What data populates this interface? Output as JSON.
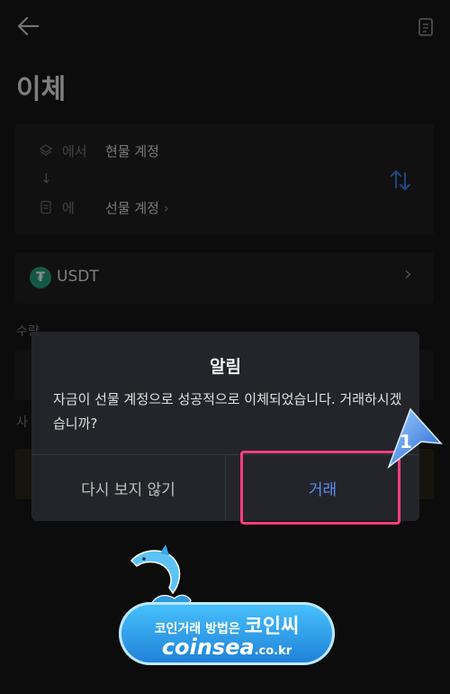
{
  "header": {
    "title": "이체",
    "back_icon": "arrow-left-icon",
    "doc_icon": "document-icon"
  },
  "transfer": {
    "from_label": "에서",
    "from_value": "현물 계정",
    "to_label": "에",
    "to_value": "선물 계정",
    "swap_icon": "swap-arrows-icon",
    "accent": "#3d7cf0"
  },
  "coin": {
    "name": "USDT",
    "icon_color": "#26a17b"
  },
  "behind": {
    "amount_label": "수량",
    "avail_label": "사"
  },
  "dialog": {
    "title": "알림",
    "message": "자금이 선물 계정으로 성공적으로 이체되었습니다. 거래하시겠습니까?",
    "cancel_label": "다시 보지 않기",
    "confirm_label": "거래",
    "confirm_color": "#5b8ff5"
  },
  "annotation": {
    "step": "1",
    "highlight_color": "#ff3d7f"
  },
  "watermark": {
    "slogan": "코인거래 방법은",
    "brand": "코인씨",
    "domain": "coinsea",
    "tld": ".co.kr"
  }
}
